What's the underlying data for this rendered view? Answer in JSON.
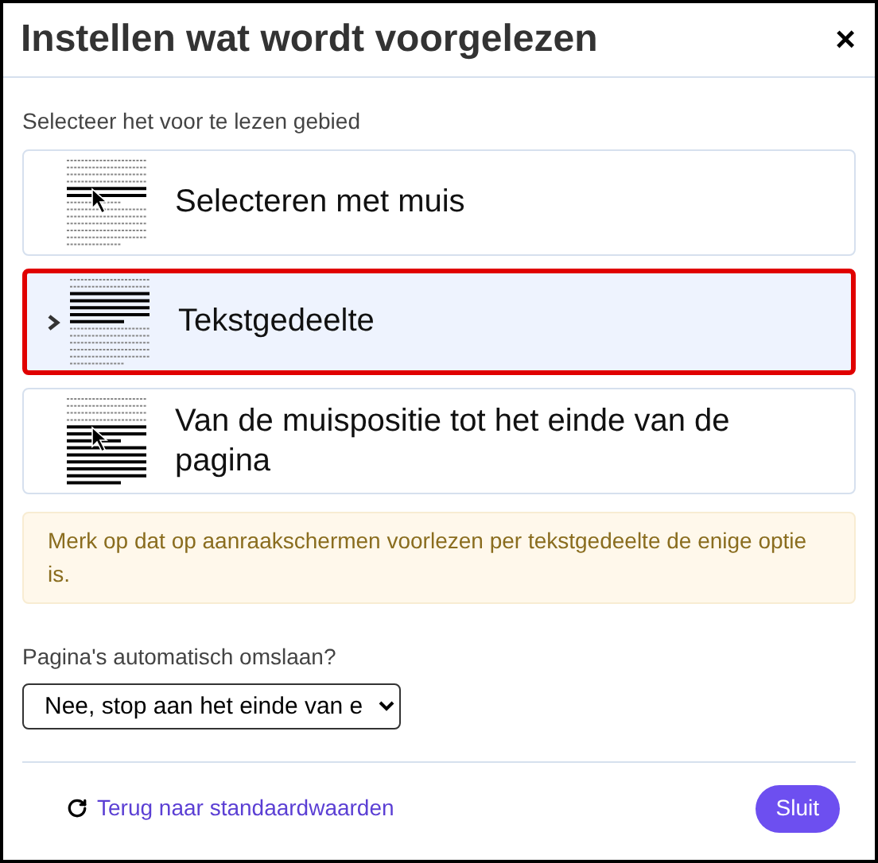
{
  "dialog": {
    "title": "Instellen wat wordt voorgelezen",
    "close": "×"
  },
  "area": {
    "label": "Selecteer het voor te lezen gebied",
    "options": [
      {
        "kind": "mouse",
        "label": "Selecteren met muis",
        "selected": false
      },
      {
        "kind": "section",
        "label": "Tekstgedeelte",
        "selected": true
      },
      {
        "kind": "to-end",
        "label": "Van de muispositie tot het einde van de pagina",
        "selected": false
      }
    ]
  },
  "notice": "Merk op dat op aanraakschermen voorlezen per tekstgedeelte de enige optie is.",
  "page_turn": {
    "label": "Pagina's automatisch omslaan?",
    "value": "Nee, stop aan het einde van e"
  },
  "footer": {
    "reset": "Terug naar standaardwaarden",
    "close_button": "Sluit"
  }
}
